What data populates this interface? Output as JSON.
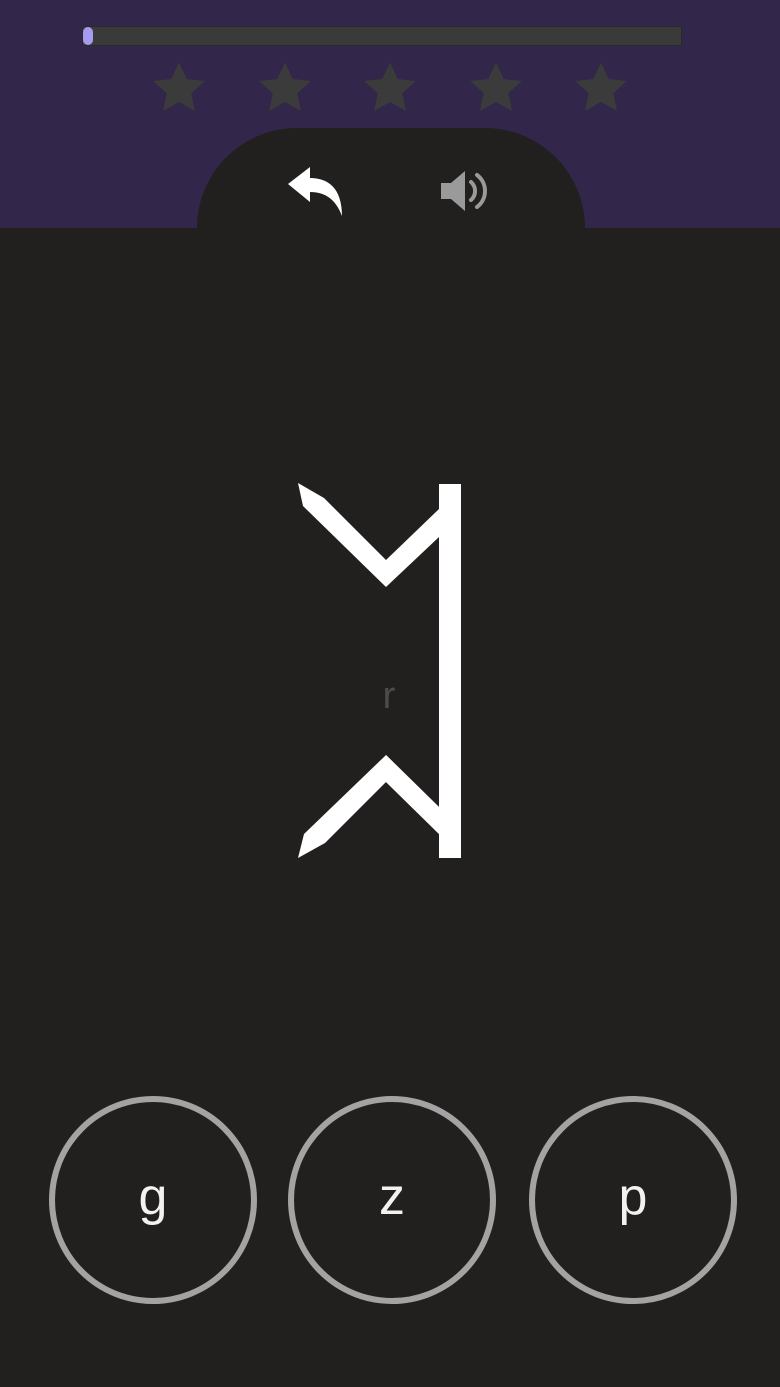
{
  "progress": {
    "fraction": 0.015,
    "fill_color": "#a69bf0",
    "track_color": "#3a3a3a"
  },
  "stars": {
    "total": 5,
    "earned": 0,
    "icon": "star-icon",
    "color": "#3b3b3b"
  },
  "controls": {
    "back_icon": "undo-arrow-icon",
    "sound_icon": "speaker-icon"
  },
  "rune": {
    "icon": "rune-glyph-icon",
    "color": "#ffffff"
  },
  "hint_text": "r",
  "answers": [
    {
      "label": "g"
    },
    {
      "label": "z"
    },
    {
      "label": "p"
    }
  ],
  "colors": {
    "header_bg": "#32264a",
    "main_bg": "#221f1f",
    "answer_ring": "#a3a3a3",
    "answer_text": "#f2f2f2"
  }
}
